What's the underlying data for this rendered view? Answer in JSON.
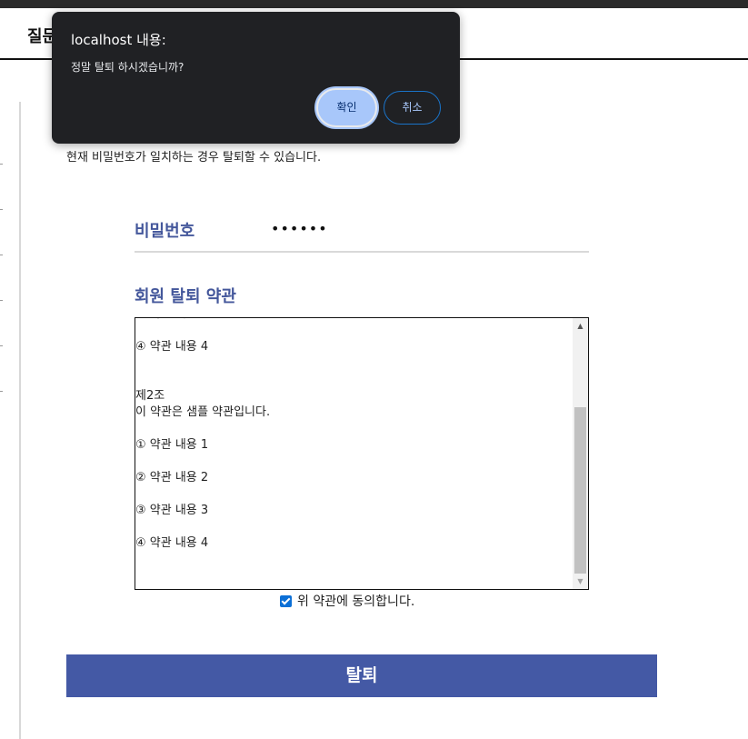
{
  "header": {
    "title": "질문"
  },
  "page": {
    "description": "현재 비밀번호가 일치하는 경우 탈퇴할 수 있습니다.",
    "password": {
      "label": "비밀번호",
      "value": "••••••"
    },
    "terms": {
      "title": "회원 탈퇴 약관",
      "lines": [
        "③ 약관 내용 3",
        "",
        "④ 약관 내용 4",
        "",
        "",
        "제2조",
        "이 약관은 샘플 약관입니다.",
        "",
        "① 약관 내용 1",
        "",
        "② 약관 내용 2",
        "",
        "③ 약관 내용 3",
        "",
        "④ 약관 내용 4"
      ],
      "agree_label": "위 약관에 동의합니다.",
      "agree_checked": true
    },
    "submit_label": "탈퇴"
  },
  "dialog": {
    "title": "localhost 내용:",
    "message": "정말 탈퇴 하시겠습니까?",
    "ok_label": "확인",
    "cancel_label": "취소"
  },
  "colors": {
    "accent": "#44579b",
    "button": "#4459a5",
    "dialog_bg": "#202124",
    "dialog_ok": "#a8c7fa"
  }
}
